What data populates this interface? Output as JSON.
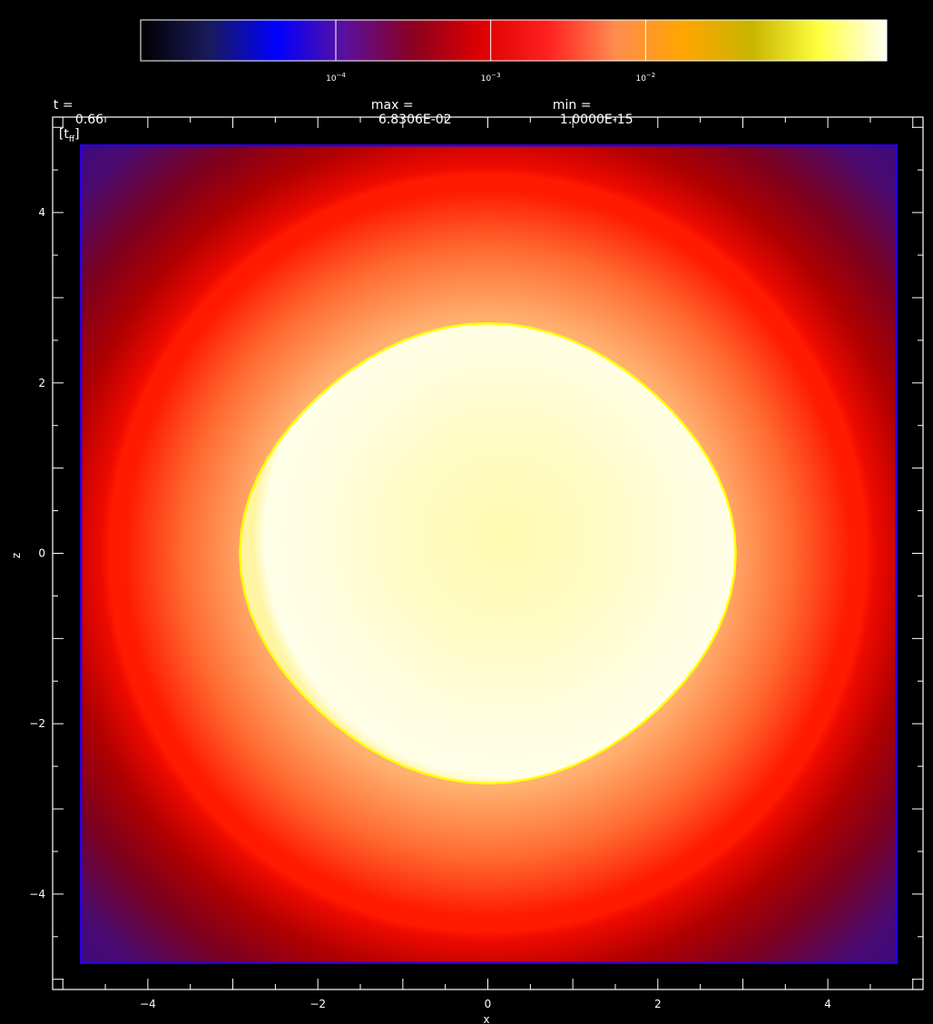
{
  "header": {
    "time_label": "t =",
    "time_value": "0.66",
    "time_unit_main": "t",
    "time_unit_sub": "ff",
    "max_label": "max =",
    "max_value": "6.8306E-02",
    "min_label": "min =",
    "min_value": "1.0000E-15"
  },
  "chart_data": {
    "type": "heatmap",
    "title": "",
    "xlabel": "x",
    "ylabel": "z",
    "xlim": [
      -5.12,
      5.12
    ],
    "ylim": [
      -5.12,
      5.12
    ],
    "x_ticks": [
      -4,
      -2,
      0,
      2,
      4
    ],
    "y_ticks": [
      -4,
      -2,
      0,
      2,
      4
    ],
    "x_tick_labels": [
      "−4",
      "−2",
      "0",
      "2",
      "4"
    ],
    "y_tick_labels": [
      "−4",
      "−2",
      "0",
      "2",
      "4"
    ],
    "field_max": 0.068306,
    "field_min": 1e-15,
    "colorbar": {
      "scale": "log",
      "tick_values": [
        0.0001,
        0.001,
        0.01
      ],
      "tick_labels": [
        {
          "base": "10",
          "exp": "−4"
        },
        {
          "base": "10",
          "exp": "−3"
        },
        {
          "base": "10",
          "exp": "−2"
        }
      ],
      "colors": [
        "#000000",
        "#1a1a5a",
        "#0000ff",
        "#5a10a0",
        "#8a0020",
        "#dd0000",
        "#ff2020",
        "#ff8c50",
        "#ffa500",
        "#c8b400",
        "#ffff40",
        "#fffff5"
      ]
    },
    "features": {
      "core_radius": 2.7,
      "core_color": "#fffde0",
      "core_center_color": "#fffab0",
      "core_edge_color": "#ffff00",
      "ring_radius": 4.45,
      "ring_color": "#ff1a00",
      "outer_color": "#b00000",
      "corner_color": "#4a0a70",
      "border_color": "#2a00dd"
    }
  }
}
